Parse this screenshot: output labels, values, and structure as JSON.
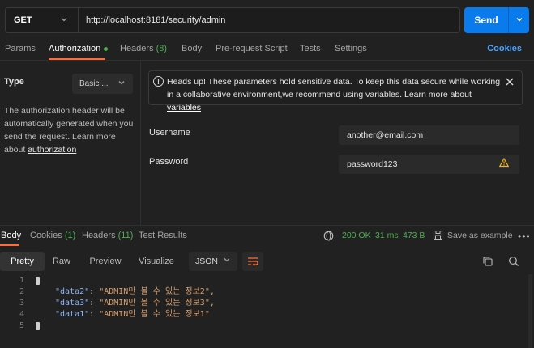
{
  "request": {
    "method": "GET",
    "url": "http://localhost:8181/security/admin",
    "send_label": "Send"
  },
  "req_tabs": {
    "params": "Params",
    "authorization": "Authorization",
    "headers": "Headers",
    "headers_count": "(8)",
    "body": "Body",
    "prerequest": "Pre-request Script",
    "tests": "Tests",
    "settings": "Settings",
    "cookies": "Cookies"
  },
  "auth": {
    "type_label": "Type",
    "type_value": "Basic ...",
    "desc_text": "The authorization header will be automatically generated when you send the request. Learn more about",
    "desc_link": "authorization"
  },
  "warning": {
    "text": "Heads up! These parameters hold sensitive data. To keep this data secure while working in a collaborative environment,we recommend using variables. Learn more about",
    "link": "variables"
  },
  "fields": {
    "username_label": "Username",
    "username_value": "another@email.com",
    "password_label": "Password",
    "password_value": "password123"
  },
  "resp_tabs": {
    "body": "Body",
    "cookies": "Cookies",
    "cookies_count": "(1)",
    "headers": "Headers",
    "headers_count": "(11)",
    "test_results": "Test Results"
  },
  "status": {
    "code": "200 OK",
    "time": "31 ms",
    "size": "473 B",
    "save": "Save as example"
  },
  "body_toolbar": {
    "pretty": "Pretty",
    "raw": "Raw",
    "preview": "Preview",
    "visualize": "Visualize",
    "format": "JSON"
  },
  "code_lines": [
    {
      "n": "1",
      "key": "",
      "val": ""
    },
    {
      "n": "2",
      "key": "\"data2\"",
      "val": "\"ADMIN만 볼 수 있는 정보2\","
    },
    {
      "n": "3",
      "key": "\"data3\"",
      "val": "\"ADMIN만 볼 수 있는 정보3\","
    },
    {
      "n": "4",
      "key": "\"data1\"",
      "val": "\"ADMIN만 볼 수 있는 정보1\""
    },
    {
      "n": "5",
      "key": "",
      "val": ""
    }
  ],
  "colors": {
    "accent": "#ff6c37",
    "send": "#097bed",
    "success": "#4caf50",
    "link": "#4aa3ff"
  },
  "icons": [
    "chevron-down-icon",
    "info-icon",
    "close-icon",
    "warning-icon",
    "globe-icon",
    "save-icon",
    "more-icon",
    "wrap-icon",
    "copy-icon",
    "search-icon"
  ]
}
